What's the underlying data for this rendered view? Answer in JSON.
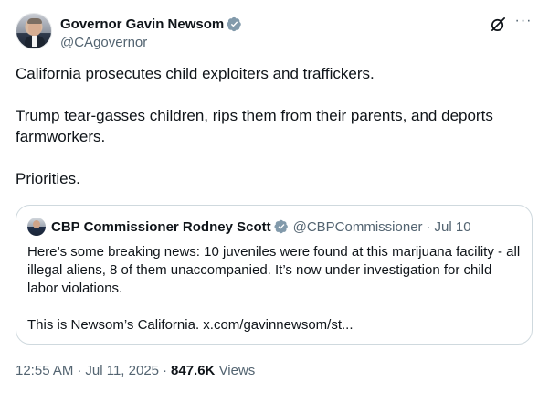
{
  "author": {
    "display_name": "Governor Gavin Newsom",
    "handle": "@CAgovernor"
  },
  "tweet": {
    "paragraphs": [
      "California prosecutes child exploiters and traffickers.",
      "Trump tear-gasses children, rips them from their parents, and deports farmworkers.",
      "Priorities."
    ]
  },
  "quoted": {
    "display_name": "CBP Commissioner Rodney Scott",
    "handle": "@CBPCommissioner",
    "separator": "·",
    "date": "Jul 10",
    "paragraphs": [
      "Here’s some breaking news: 10 juveniles were found at this marijuana facility - all illegal aliens, 8 of them unaccompanied. It’s  now under investigation for child labor violations.",
      "This is Newsom’s California. x.com/gavinnewsom/st..."
    ]
  },
  "meta": {
    "time": "12:55 AM",
    "separator": "·",
    "date": "Jul 11, 2025",
    "views_count": "847.6K",
    "views_label": "Views"
  },
  "colors": {
    "verified_badge": "#829aab",
    "secondary_text": "#536471",
    "primary_text": "#0f1419",
    "border": "#cfd9de"
  },
  "icons": {
    "verified": "verified-badge-icon",
    "grok": "grok-icon",
    "more": "more-options-icon"
  }
}
